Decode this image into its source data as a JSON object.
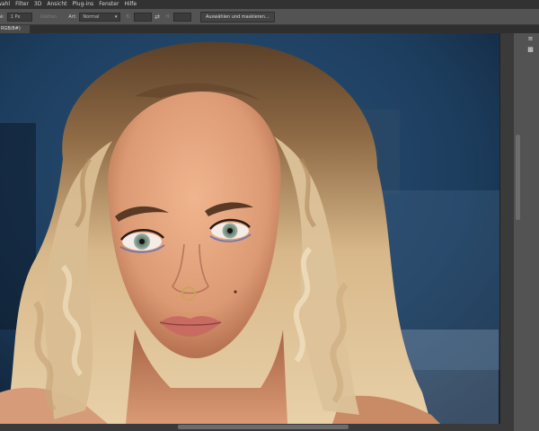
{
  "menubar": {
    "items": [
      "wahl",
      "Filter",
      "3D",
      "Ansicht",
      "Plug-ins",
      "Fenster",
      "Hilfe"
    ]
  },
  "options": {
    "feather_label": "é:",
    "feather_value": "1 Px",
    "smooth_label": "Glätten",
    "style_label": "Art:",
    "style_value": "Normal",
    "width_label": "B:",
    "height_label": "H:",
    "select_mask_label": "Auswählen und maskieren..."
  },
  "document": {
    "tab_label": "RGB/8#)"
  },
  "icons": {
    "swap": "swap-arrows-icon",
    "panel_top": "panel-arrows-icon",
    "panel_comment": "comment-icon"
  },
  "colors": {
    "background_wall": "#1c3b5a",
    "hair": "#d8b88a",
    "skin": "#e3a27c"
  }
}
